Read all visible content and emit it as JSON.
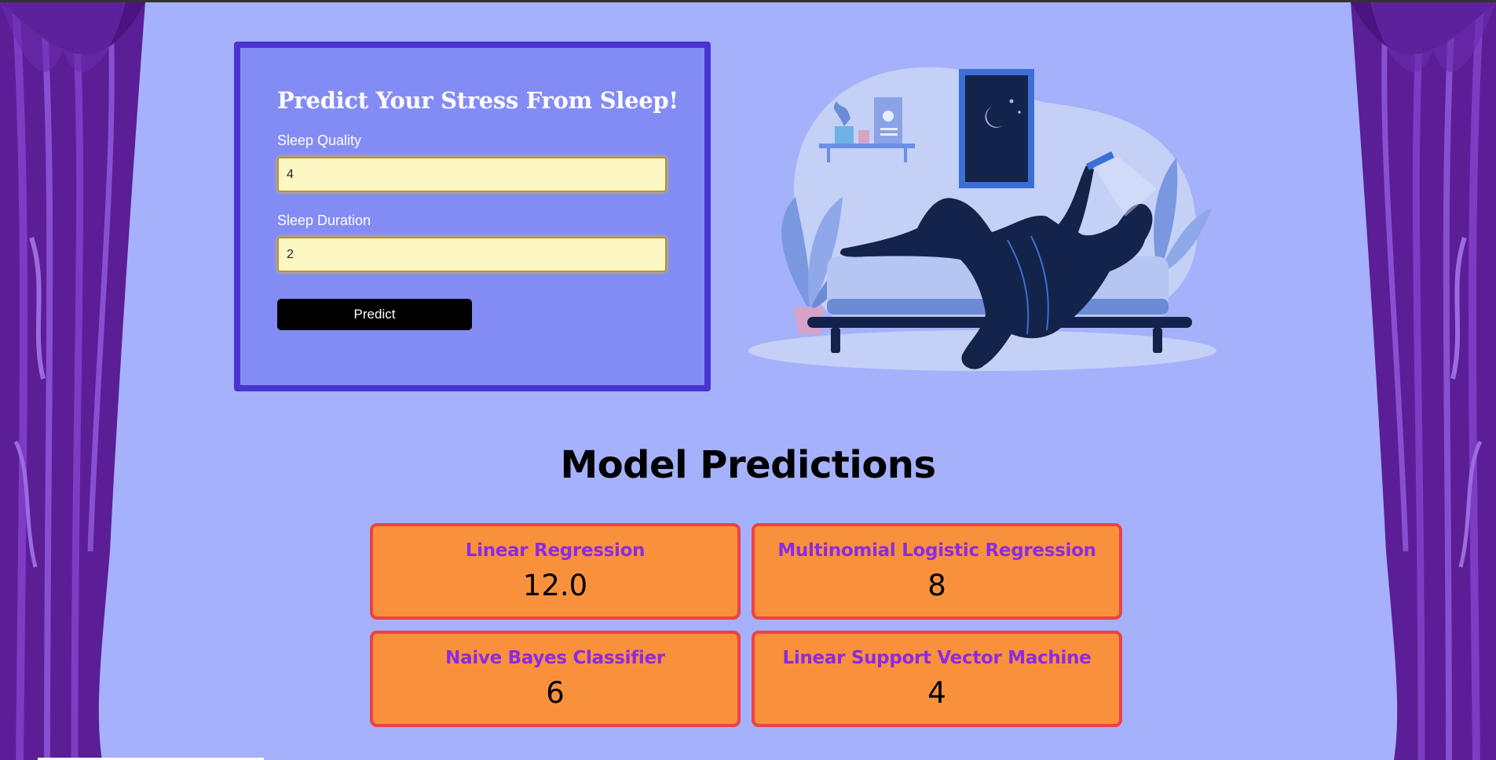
{
  "form": {
    "title": "Predict Your Stress From Sleep!",
    "sleep_quality_label": "Sleep Quality",
    "sleep_quality_value": "4",
    "sleep_duration_label": "Sleep Duration",
    "sleep_duration_value": "2",
    "predict_label": "Predict"
  },
  "results": {
    "title": "Model Predictions",
    "models": [
      {
        "name": "Linear Regression",
        "value": "12.0"
      },
      {
        "name": "Multinomial Logistic Regression",
        "value": "8"
      },
      {
        "name": "Naive Bayes Classifier",
        "value": "6"
      },
      {
        "name": "Linear Support Vector Machine",
        "value": "4"
      }
    ]
  },
  "colors": {
    "background": "#a5b1fb",
    "form_card": "#838cf5",
    "form_border": "#4934d2",
    "card_fill": "#f9913c",
    "card_border": "#ec4245",
    "model_name": "#8a2be2",
    "curtain": "#5b1e96"
  },
  "icons": {
    "illustration": "person-lying-on-bed-with-phone-illustration",
    "curtain": "purple-curtain-decoration"
  }
}
